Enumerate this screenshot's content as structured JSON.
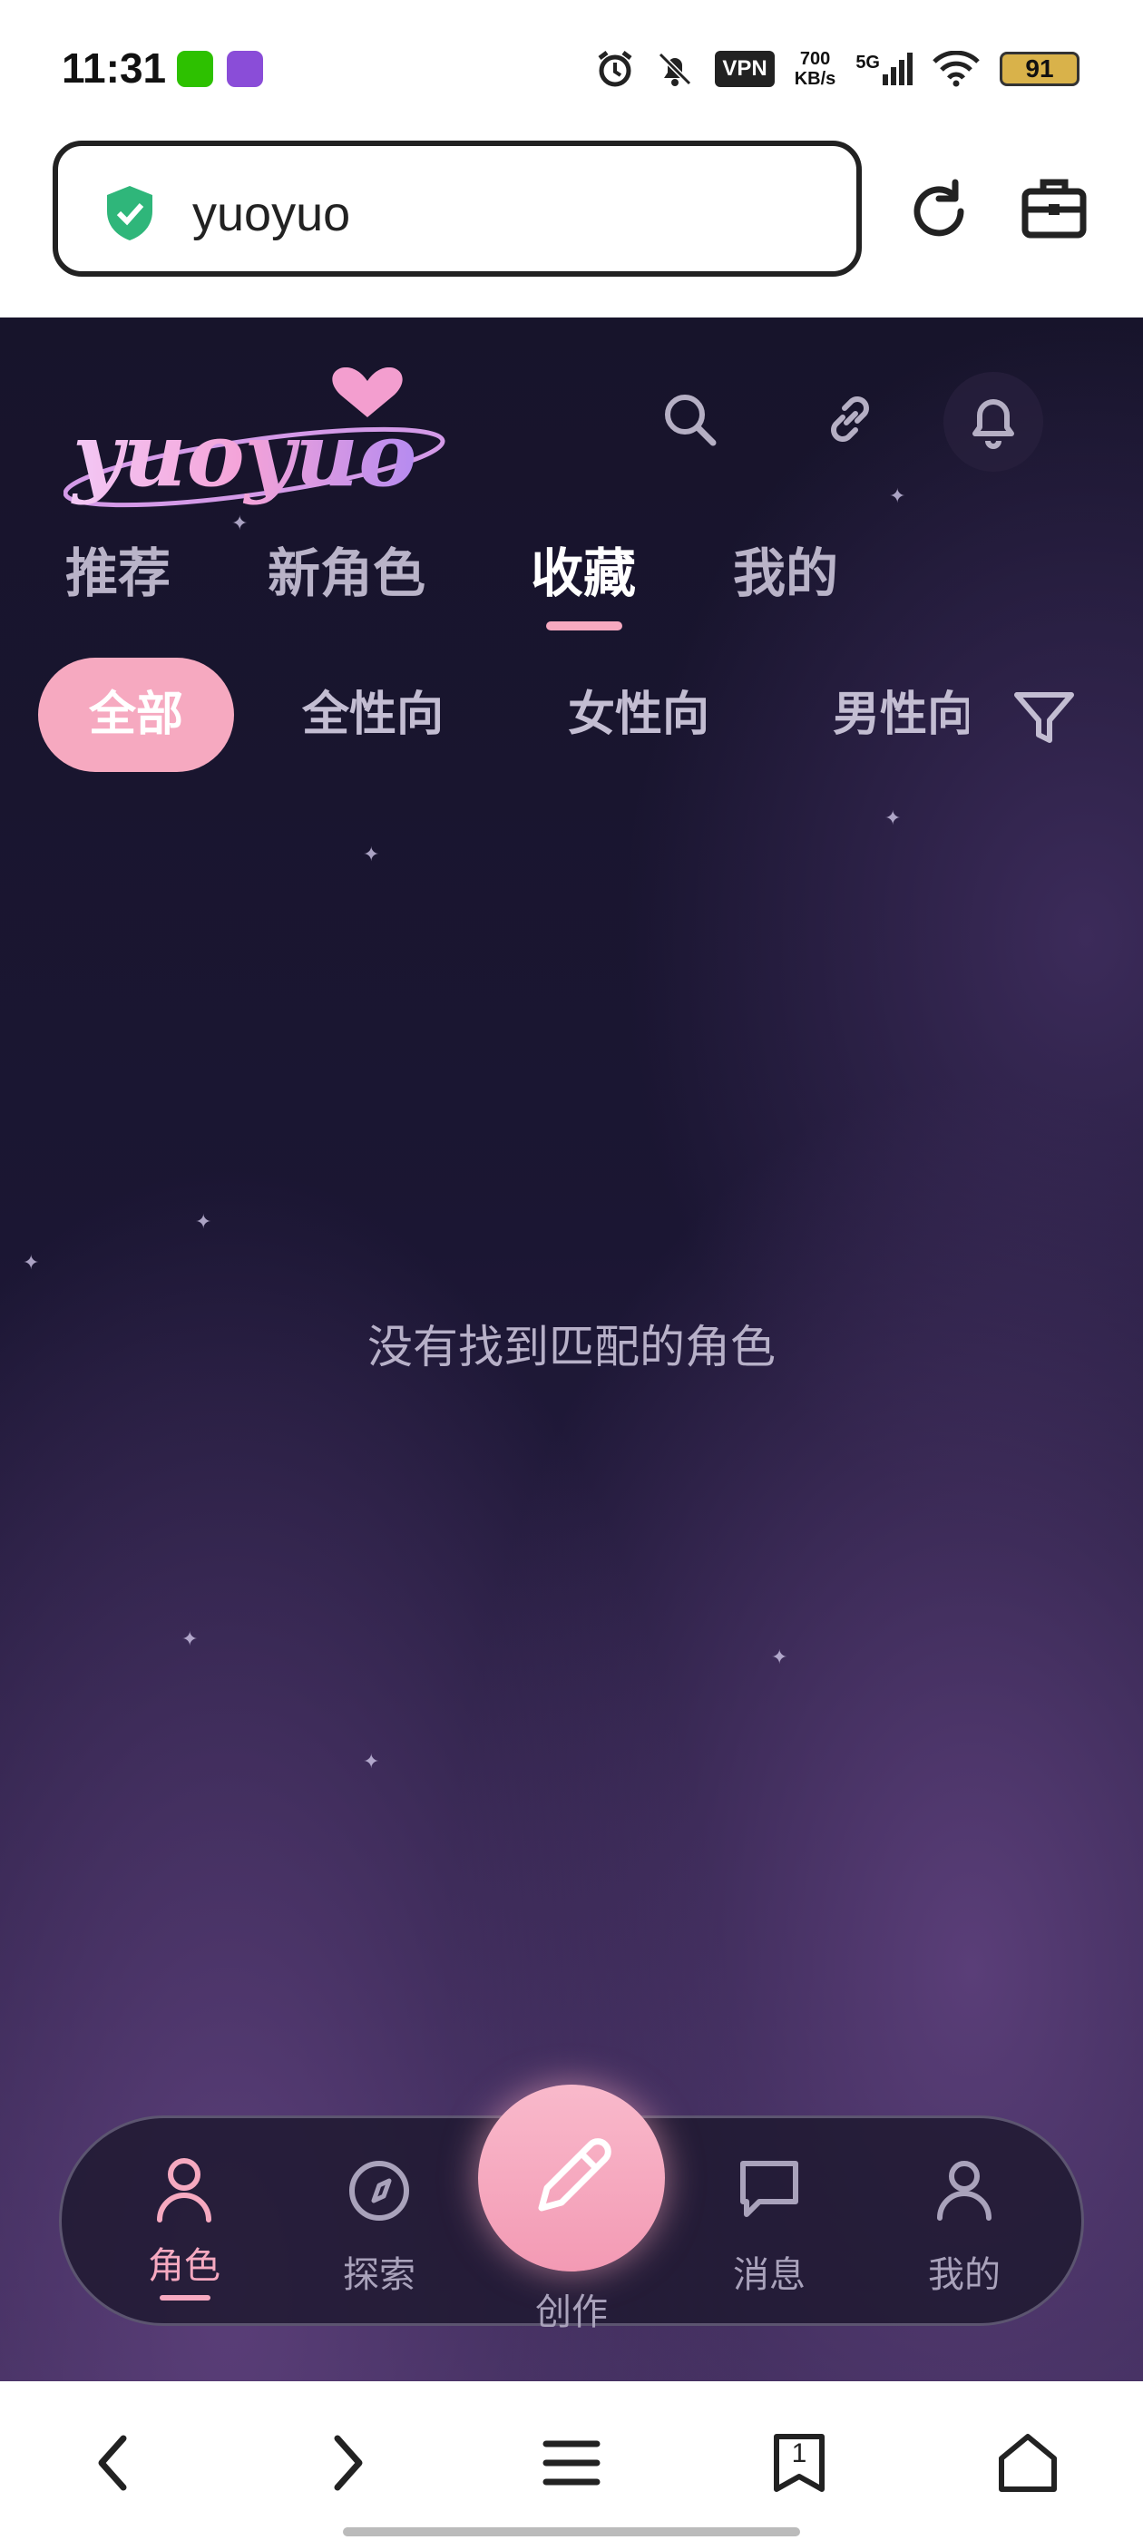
{
  "status_bar": {
    "time": "11:31",
    "vpn_label": "VPN",
    "net_speed_value": "700",
    "net_speed_unit": "KB/s",
    "network": "5G",
    "battery_level": "91"
  },
  "address_bar": {
    "url": "yuoyuo"
  },
  "header": {
    "logo_text": "yuoyuo"
  },
  "tabs": [
    {
      "label": "推荐"
    },
    {
      "label": "新角色"
    },
    {
      "label": "收藏"
    },
    {
      "label": "我的"
    }
  ],
  "active_tab": "收藏",
  "filter_chips": [
    {
      "label": "全部"
    },
    {
      "label": "全性向"
    },
    {
      "label": "女性向"
    },
    {
      "label": "男性向"
    }
  ],
  "active_chip": "全部",
  "empty_state": {
    "message": "没有找到匹配的角色"
  },
  "bottom_nav": {
    "items": [
      {
        "label": "角色",
        "icon": "person-icon"
      },
      {
        "label": "探索",
        "icon": "compass-icon"
      },
      {
        "label": "创作",
        "icon": "pencil-icon"
      },
      {
        "label": "消息",
        "icon": "chat-bubble-icon"
      },
      {
        "label": "我的",
        "icon": "user-icon"
      }
    ],
    "active": "角色"
  },
  "browser_bar": {
    "tab_count": "1"
  },
  "colors": {
    "accent_pink": "#f6a9c0",
    "background_dark": "#17142b"
  }
}
